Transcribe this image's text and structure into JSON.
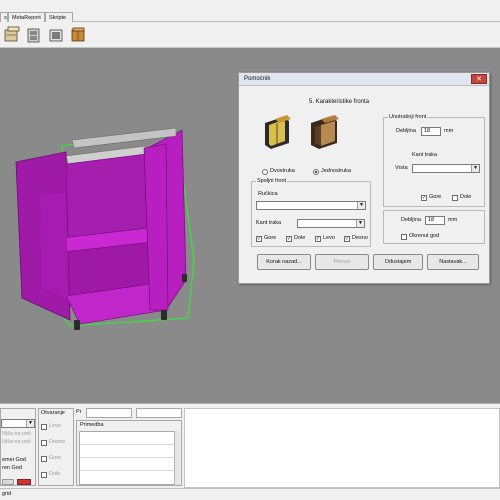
{
  "tabs": [
    {
      "label": "s"
    },
    {
      "label": "MetaReport"
    },
    {
      "label": "Skripte"
    }
  ],
  "toolbar": {
    "icons": [
      "cabinet-view-icon-1",
      "cabinet-view-icon-2",
      "cabinet-view-icon-3",
      "cabinet-view-icon-4"
    ]
  },
  "dialog": {
    "title": "Pomoćnik",
    "close_glyph": "✕",
    "step_title": "5. Karakteristike fronta",
    "front_type": {
      "option_double": "Dvostruka",
      "option_single": "Jednostruka",
      "selected": "Jednostruka"
    },
    "outer_front": {
      "group_label": "Spoljni front",
      "handle_label": "Ručkica",
      "handle_value": "",
      "edge_label": "Kant traka",
      "edge_value": "",
      "edges": [
        {
          "label": "Gore",
          "checked": true
        },
        {
          "label": "Dole",
          "checked": true
        },
        {
          "label": "Levo",
          "checked": true
        },
        {
          "label": "Desno",
          "checked": true
        }
      ]
    },
    "inner_front": {
      "group_label": "Unutrašnji front",
      "thickness_label": "Debljina",
      "thickness_value": "18",
      "thickness_unit": "mm",
      "edge_label": "Kant traka",
      "type_label": "Vrsta",
      "type_value": "",
      "edges": [
        {
          "label": "Gore",
          "checked": true
        },
        {
          "label": "Dole",
          "checked": false
        }
      ]
    },
    "thickness": {
      "label": "Debljina",
      "value": "18",
      "unit": "mm"
    },
    "rotate_grain": {
      "label": "Okrenut god",
      "checked": false
    },
    "buttons": {
      "back": "Korak nazad...",
      "help": "Pomoć",
      "cancel": "Odustajem",
      "next": "Nastavak..."
    }
  },
  "bottom_panel": {
    "opening_label": "Otvaranje",
    "opening_items": [
      "Levo",
      "Desno",
      "Gore",
      "Dole"
    ],
    "left_items": [
      "Niša na poli",
      "Niša na poli",
      "emei God",
      "ren God"
    ],
    "note_label": "Primedba",
    "field_label": "Pr"
  },
  "status": {
    "text": "grid"
  }
}
